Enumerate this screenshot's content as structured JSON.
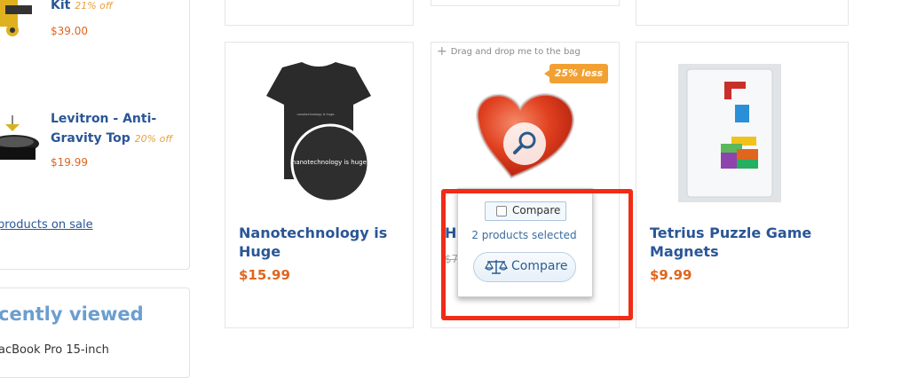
{
  "sidebar": {
    "sale_items": [
      {
        "name": "Kit",
        "discount": "21% off",
        "price": "$39.00"
      },
      {
        "name": "Levitron - Anti-Gravity Top",
        "discount": "20% off",
        "price": "$19.99"
      }
    ],
    "sale_link": "products on sale",
    "recently_viewed_title": "cently viewed",
    "recently_viewed_item": "acBook Pro 15-inch"
  },
  "products": [
    {
      "name": "Nanotechnology is Huge",
      "price": "$15.99",
      "shirt_text": "nanotechnology is huge."
    },
    {
      "name": "H",
      "price": "$7",
      "drag_hint": "Drag and drop me to the bag",
      "badge": "25% less"
    },
    {
      "name": "Tetrius Puzzle Game Magnets",
      "price": "$9.99"
    }
  ],
  "compare": {
    "checkbox_label": "Compare",
    "selected_text": "2 products selected",
    "button_label": "Compare"
  },
  "colors": {
    "link": "#2a5697",
    "price": "#e0651e",
    "badge": "#f3a032",
    "highlight": "#f12c16"
  }
}
